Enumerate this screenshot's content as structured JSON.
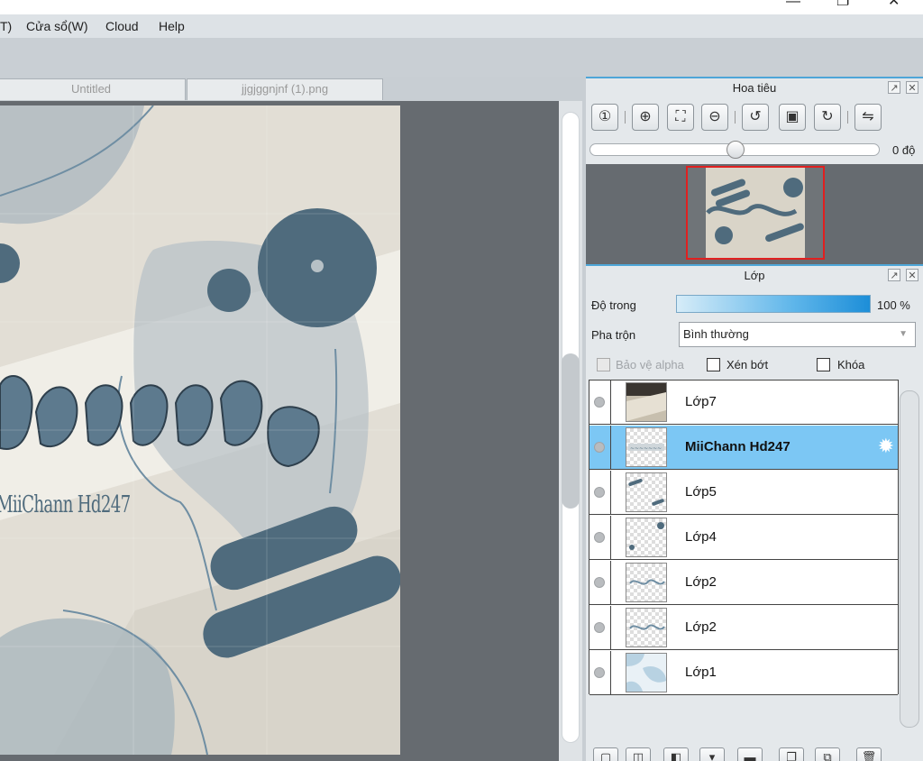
{
  "window": {
    "minimize_glyph": "—",
    "maximize_glyph": "❐",
    "close_glyph": "✕"
  },
  "menu": {
    "items": [
      "T)",
      "Cửa sổ(W)",
      "Cloud",
      "Help"
    ]
  },
  "tabs": [
    {
      "label": "Untitled"
    },
    {
      "label": "jjgjggnjnf (1).png"
    }
  ],
  "canvas": {
    "signature_text": "MiiChann Hd247",
    "colors": {
      "background": "#e6e2d9",
      "shape": "#4f6b7d",
      "shape_light": "#aab6bd"
    }
  },
  "navigator": {
    "title": "Hoa tiêu",
    "rotation_label": "0 độ",
    "rotation_value": 0,
    "tools": [
      "zoom-actual-icon",
      "zoom-in-icon",
      "fit-window-icon",
      "zoom-out-icon",
      "rotate-left-icon",
      "fit-screen-icon",
      "rotate-right-icon",
      "flip-horizontal-icon"
    ]
  },
  "layers_panel": {
    "title": "Lớp",
    "opacity_label": "Độ trong",
    "opacity_value": "100 %",
    "blend_label": "Pha trộn",
    "blend_value": "Bình thường",
    "protect_alpha_label": "Bảo vệ alpha",
    "clipping_label": "Xén bớt",
    "lock_label": "Khóa",
    "layers": [
      {
        "name": "Lớp7",
        "selected": false
      },
      {
        "name": "MiiChann Hd247",
        "selected": true
      },
      {
        "name": "Lớp5",
        "selected": false
      },
      {
        "name": "Lớp4",
        "selected": false
      },
      {
        "name": "Lớp2",
        "selected": false
      },
      {
        "name": "Lớp2",
        "selected": false
      },
      {
        "name": "Lớp1",
        "selected": false
      }
    ],
    "accent_color": "#7cc7f4"
  }
}
